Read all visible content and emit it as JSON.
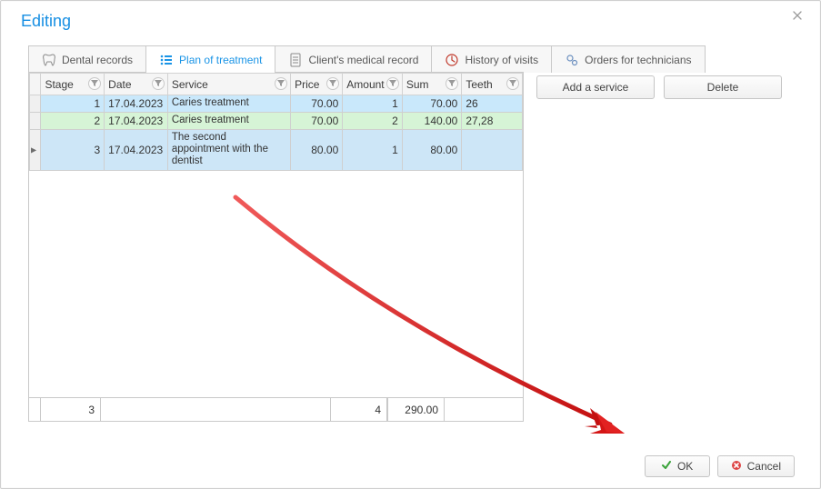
{
  "title": "Editing",
  "tabs": {
    "dental": {
      "label": "Dental records"
    },
    "plan": {
      "label": "Plan of treatment"
    },
    "client": {
      "label": "Client's medical record"
    },
    "history": {
      "label": "History of visits"
    },
    "orders": {
      "label": "Orders for technicians"
    }
  },
  "grid": {
    "headers": {
      "stage": "Stage",
      "date": "Date",
      "service": "Service",
      "price": "Price",
      "amount": "Amount",
      "sum": "Sum",
      "teeth": "Teeth"
    },
    "rows": [
      {
        "stage": "1",
        "date": "17.04.2023",
        "service": "Caries treatment",
        "price": "70.00",
        "amount": "1",
        "sum": "70.00",
        "teeth": "26"
      },
      {
        "stage": "2",
        "date": "17.04.2023",
        "service": "Caries treatment",
        "price": "70.00",
        "amount": "2",
        "sum": "140.00",
        "teeth": "27,28"
      },
      {
        "stage": "3",
        "date": "17.04.2023",
        "service": "The second appointment with the dentist",
        "price": "80.00",
        "amount": "1",
        "sum": "80.00",
        "teeth": ""
      }
    ],
    "footer": {
      "stage_total": "3",
      "amount_total": "4",
      "sum_total": "290.00"
    }
  },
  "buttons": {
    "add_service": "Add a service",
    "delete": "Delete",
    "ok": "OK",
    "cancel": "Cancel"
  }
}
